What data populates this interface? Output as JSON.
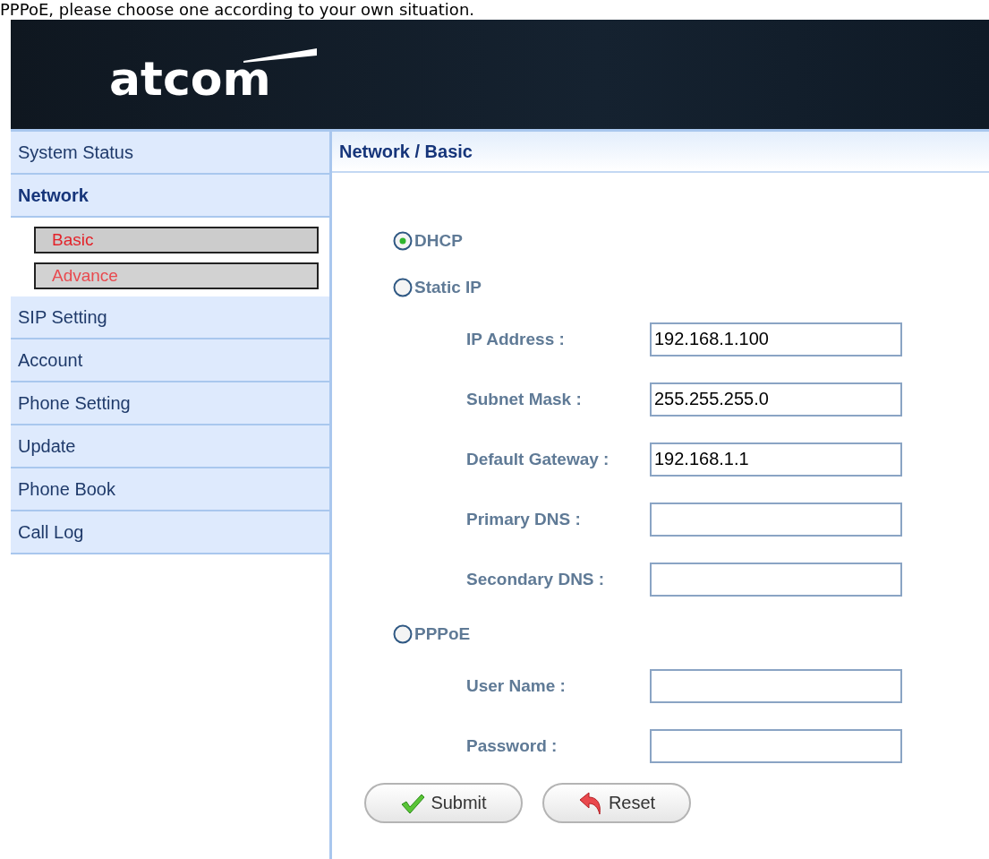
{
  "caption": "PPPoE, please choose one according to your own situation.",
  "header": {
    "logo": "atcom"
  },
  "sidebar": {
    "items": [
      {
        "label": "System Status",
        "selected": false
      },
      {
        "label": "Network",
        "selected": true,
        "children": [
          {
            "label": "Basic",
            "selected": true
          },
          {
            "label": "Advance",
            "selected": false
          }
        ]
      },
      {
        "label": "SIP Setting",
        "selected": false
      },
      {
        "label": "Account",
        "selected": false
      },
      {
        "label": "Phone Setting",
        "selected": false
      },
      {
        "label": "Update",
        "selected": false
      },
      {
        "label": "Phone Book",
        "selected": false
      },
      {
        "label": "Call Log",
        "selected": false
      }
    ]
  },
  "breadcrumb": "Network / Basic",
  "modes": [
    {
      "label": "DHCP",
      "selected": true
    },
    {
      "label": "Static IP",
      "selected": false,
      "fields": [
        {
          "label": "IP Address :",
          "value": "192.168.1.100"
        },
        {
          "label": "Subnet Mask :",
          "value": "255.255.255.0"
        },
        {
          "label": "Default Gateway :",
          "value": "192.168.1.1"
        },
        {
          "label": "Primary DNS :"
        },
        {
          "label": "Secondary DNS :"
        }
      ]
    },
    {
      "label": "PPPoE",
      "selected": false,
      "fields": [
        {
          "label": "User Name :"
        },
        {
          "label": "Password :"
        }
      ]
    }
  ],
  "buttons": [
    {
      "label": "Submit",
      "kind": "submit"
    },
    {
      "label": "Reset",
      "kind": "reset"
    }
  ]
}
